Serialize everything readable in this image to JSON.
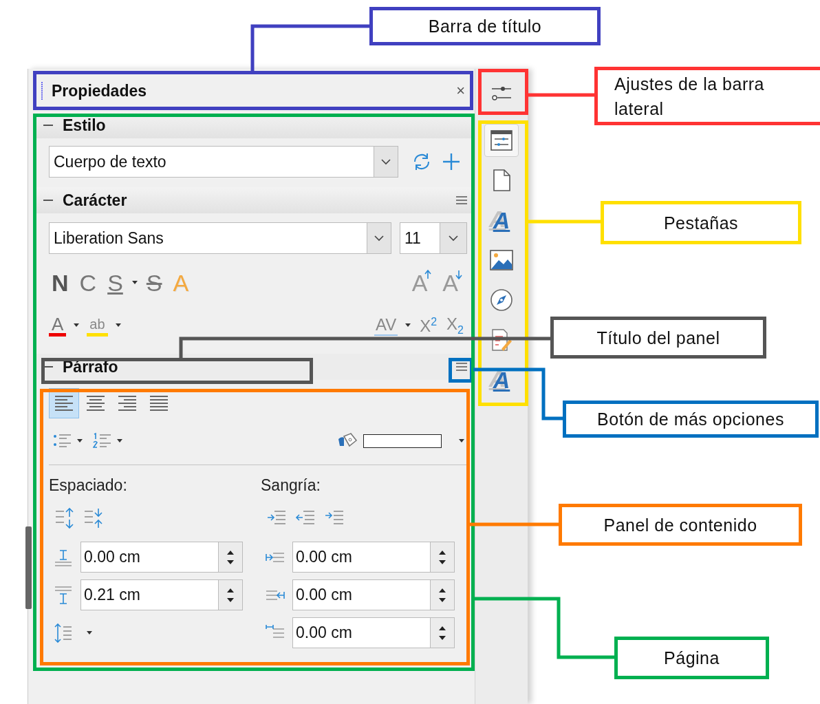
{
  "sidebar": {
    "title": "Propiedades",
    "close": "×",
    "style_panel": {
      "title": "Estilo",
      "value": "Cuerpo de texto"
    },
    "character_panel": {
      "title": "Carácter",
      "font": "Liberation Sans",
      "size": "11",
      "format_buttons": [
        {
          "glyph": "N",
          "kind": "bold"
        },
        {
          "glyph": "C",
          "kind": "italic"
        },
        {
          "glyph": "S",
          "kind": "underline"
        },
        {
          "glyph": "S",
          "kind": "strike"
        },
        {
          "glyph": "A",
          "kind": "shadow"
        }
      ],
      "grow": "A",
      "shrink": "A",
      "font_color": "A",
      "highlight": "ab",
      "spacing": "AV",
      "superscript": "X$^{2}$",
      "subscript": "X$_{2}$"
    },
    "paragraph_panel": {
      "title": "Párrafo",
      "align": [
        {
          "kind": "left",
          "selected": true
        },
        {
          "kind": "center",
          "selected": false
        },
        {
          "kind": "right",
          "selected": false
        },
        {
          "kind": "justify",
          "selected": false
        }
      ],
      "spacing_label": "Espaciado:",
      "indent_label": "Sangría:",
      "spacing_fields": [
        "0.00 cm",
        "0.21 cm"
      ],
      "indent_fields": [
        "0.00 cm",
        "0.00 cm",
        "0.00 cm"
      ]
    }
  },
  "tabs": [
    {
      "kind": "properties",
      "selected": true
    },
    {
      "kind": "page",
      "selected": false
    },
    {
      "kind": "styles",
      "glyph": "A",
      "selected": false
    },
    {
      "kind": "gallery",
      "selected": false
    },
    {
      "kind": "navigator",
      "selected": false
    },
    {
      "kind": "manage",
      "selected": false
    },
    {
      "kind": "styles",
      "glyph": "A",
      "selected": false
    }
  ],
  "callouts": [
    {
      "label": "Barra de título",
      "color": "#4040c0"
    },
    {
      "label": "Ajustes de la barra lateral",
      "color": "#ff3333"
    },
    {
      "label": "Pestañas",
      "color": "#ffe000"
    },
    {
      "label": "Título del panel",
      "color": "#555555"
    },
    {
      "label": "Botón de más opciones",
      "color": "#0070c0"
    },
    {
      "label": "Panel de contenido",
      "color": "#ff7a00"
    },
    {
      "label": "Página",
      "color": "#00b050"
    }
  ]
}
